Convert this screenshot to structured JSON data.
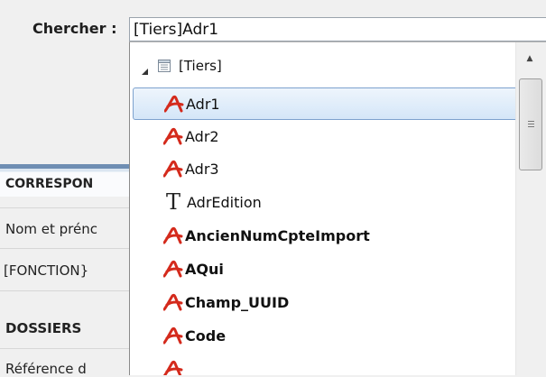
{
  "search": {
    "label": "Chercher :",
    "value": "[Tiers]Adr1"
  },
  "background_form": {
    "section_title": "CORRESPON",
    "row_label": "Nom et prénc",
    "row_value": "[FONCTION}",
    "section_title_2": "DOSSIERS",
    "row_label_2": "Référence d"
  },
  "tree": {
    "root": {
      "label": "[Tiers]",
      "expanded": true,
      "icon": "table-icon"
    },
    "items": [
      {
        "label": "Adr1",
        "icon": "field-icon",
        "bold": false,
        "selected": true
      },
      {
        "label": "Adr2",
        "icon": "field-icon",
        "bold": false,
        "selected": false
      },
      {
        "label": "Adr3",
        "icon": "field-icon",
        "bold": false,
        "selected": false
      },
      {
        "label": "AdrEdition",
        "icon": "text-icon",
        "bold": false,
        "selected": false
      },
      {
        "label": "AncienNumCpteImport",
        "icon": "field-icon",
        "bold": true,
        "selected": false
      },
      {
        "label": "AQui",
        "icon": "field-icon",
        "bold": true,
        "selected": false
      },
      {
        "label": "Champ_UUID",
        "icon": "field-icon",
        "bold": true,
        "selected": false
      },
      {
        "label": "Code",
        "icon": "field-icon",
        "bold": true,
        "selected": false
      }
    ]
  },
  "colors": {
    "selection_border": "#7da2ce",
    "field_icon_red": "#d42a1c"
  }
}
